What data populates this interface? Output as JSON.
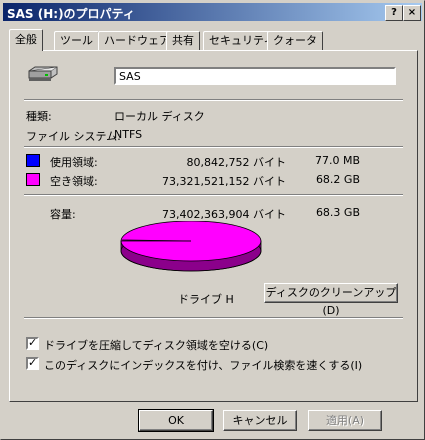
{
  "window": {
    "title": "SAS (H:)のプロパティ",
    "help_label": "?",
    "close_label": "×"
  },
  "tabs": [
    "全般",
    "ツール",
    "ハードウェア",
    "共有",
    "セキュリティ",
    "クォータ"
  ],
  "general": {
    "drive_name": "SAS",
    "type_label": "種類:",
    "type_value": "ローカル ディスク",
    "fs_label": "ファイル システム:",
    "fs_value": "NTFS",
    "used": {
      "label": "使用領域:",
      "bytes": "80,842,752 バイト",
      "size": "77.0 MB",
      "color": "#0000ff"
    },
    "free": {
      "label": "空き領域:",
      "bytes": "73,321,521,152 バイト",
      "size": "68.2 GB",
      "color": "#ff00ff"
    },
    "capacity": {
      "label": "容量:",
      "bytes": "73,402,363,904 バイト",
      "size": "68.3 GB"
    },
    "drive_label": "ドライブ H",
    "cleanup_label": "ディスクのクリーンアップ(D)",
    "compress_label": "ドライブを圧縮してディスク領域を空ける(C)",
    "index_label": "このディスクにインデックスを付け、ファイル検索を速くする(I)"
  },
  "buttons": {
    "ok": "OK",
    "cancel": "キャンセル",
    "apply": "適用(A)"
  }
}
